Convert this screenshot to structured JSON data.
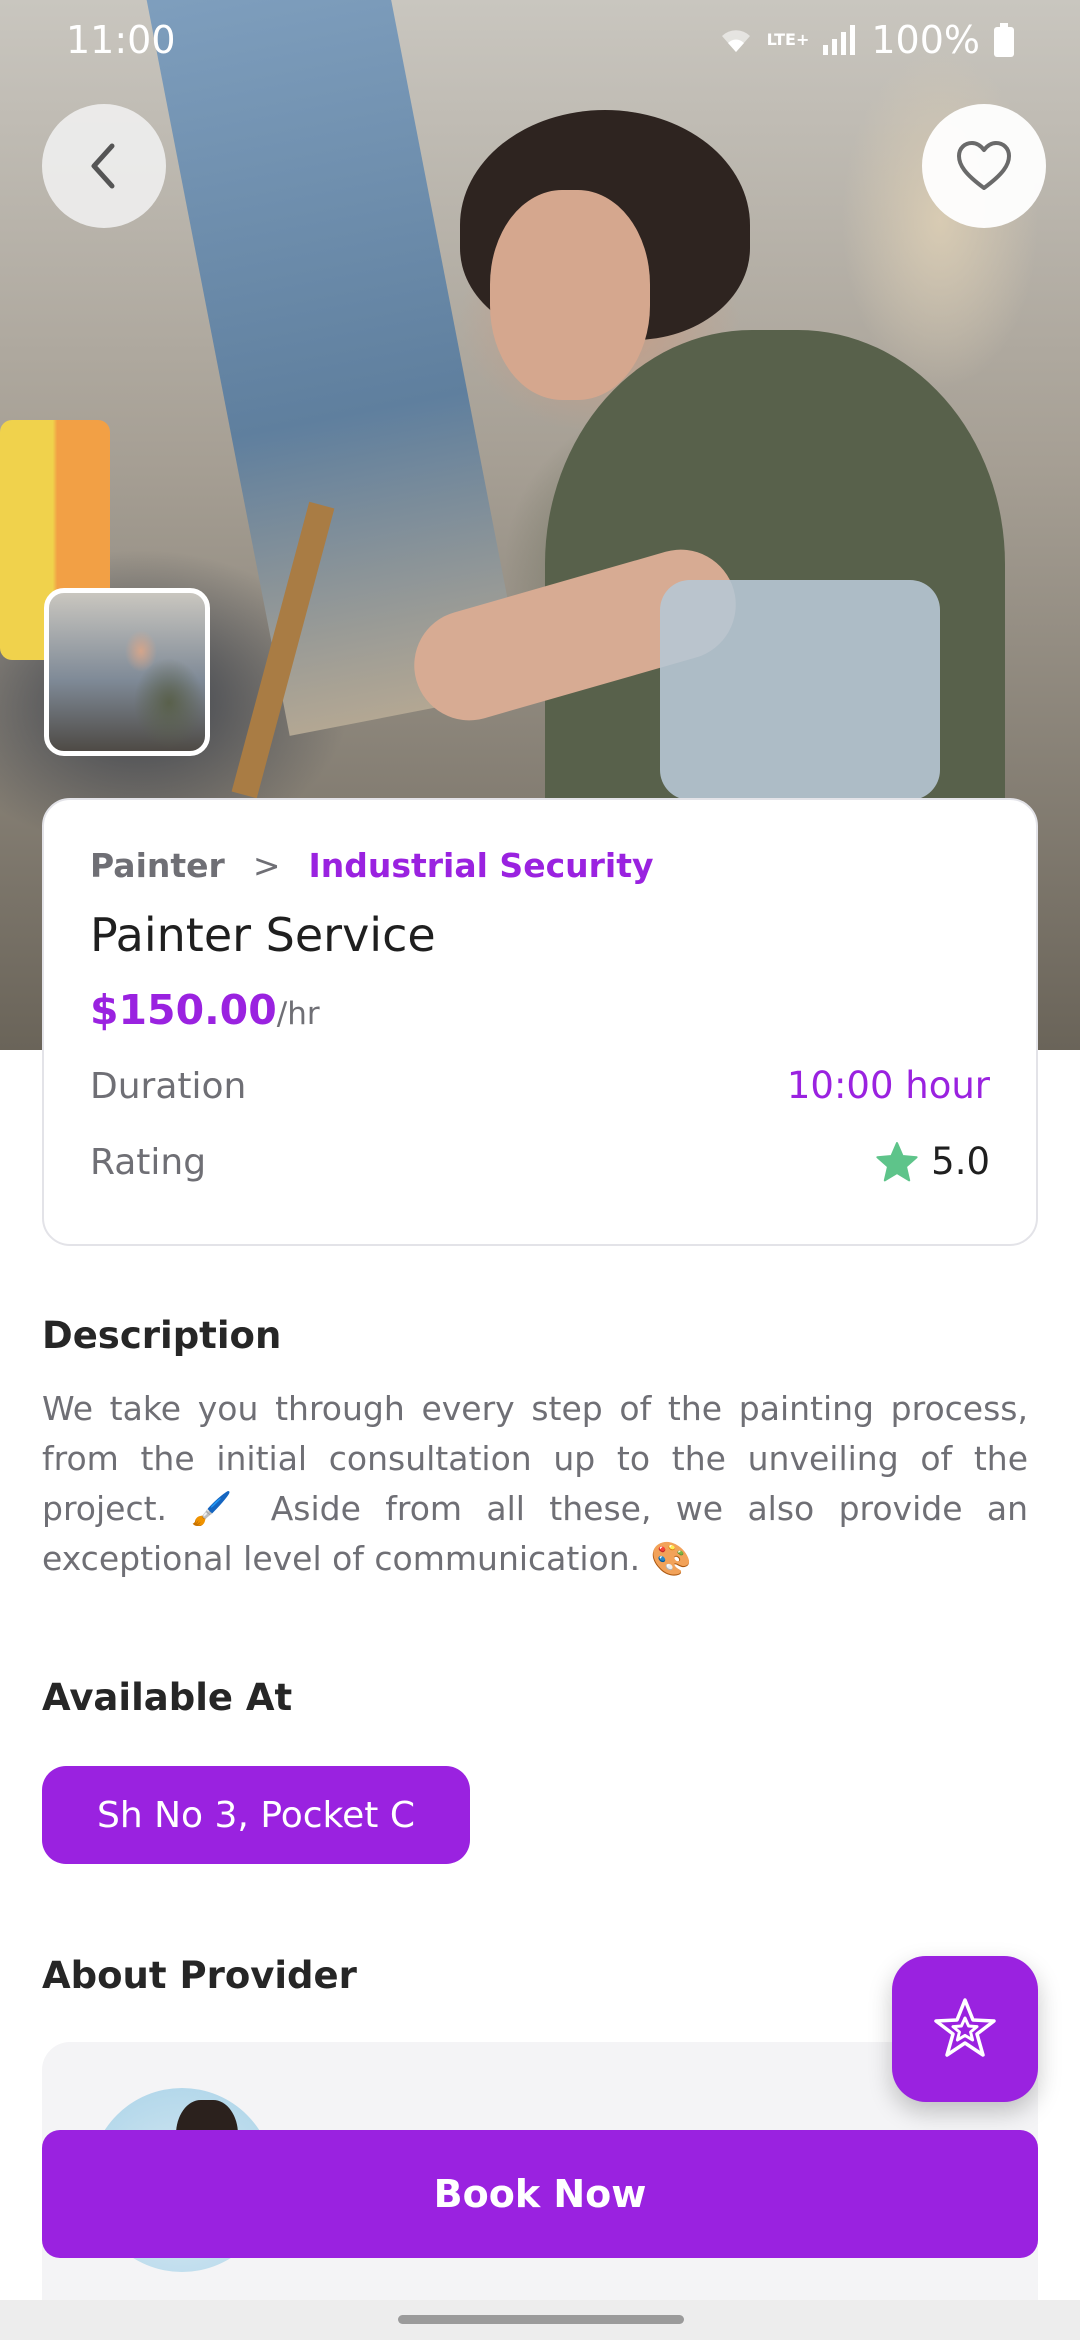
{
  "status_bar": {
    "time": "11:00",
    "network": "LTE+",
    "battery": "100%"
  },
  "hero": {
    "image": "painter-at-work-photo"
  },
  "service": {
    "breadcrumb_category": "Painter",
    "breadcrumb_separator": ">",
    "breadcrumb_subcategory": "Industrial Security",
    "title": "Painter Service",
    "price": "$150.00",
    "price_unit": "/hr",
    "duration_label": "Duration",
    "duration_value": "10:00 hour",
    "rating_label": "Rating",
    "rating_value": "5.0"
  },
  "description": {
    "title": "Description",
    "text": "We take you through every step of the painting process, from the initial consultation up to the unveiling of the project. 🖌️ Aside from all these, we also provide an exceptional level of communication. 🎨"
  },
  "available_at": {
    "title": "Available At",
    "address": "Sh No 3, Pocket C"
  },
  "about_provider": {
    "title": "About Provider"
  },
  "actions": {
    "book_now": "Book Now"
  },
  "colors": {
    "accent": "#9a22e0",
    "star": "#5ec48a",
    "text_muted": "#6f6f75"
  },
  "icons": {
    "back": "chevron-left-icon",
    "favorite": "heart-outline-icon",
    "fab": "star-badge-icon",
    "rating": "star-icon"
  }
}
